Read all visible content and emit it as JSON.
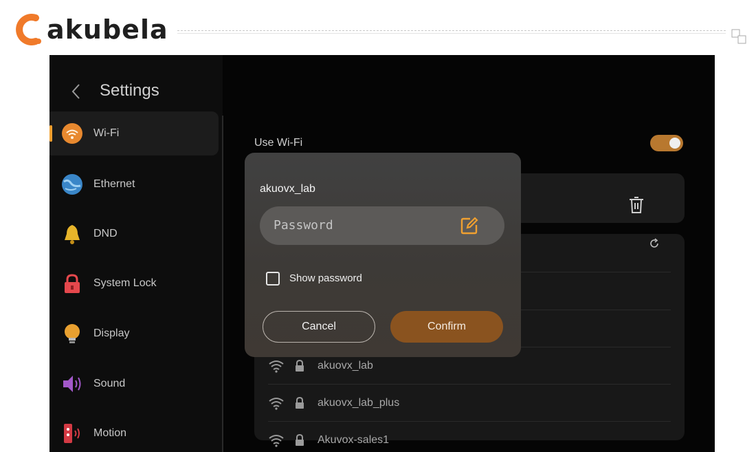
{
  "brand": {
    "name": "akubela",
    "accent": "#f0a030"
  },
  "header": {
    "title": "Settings"
  },
  "sidebar": {
    "items": [
      {
        "label": "Wi-Fi",
        "icon": "wifi-icon",
        "active": true
      },
      {
        "label": "Ethernet",
        "icon": "globe-icon",
        "active": false
      },
      {
        "label": "DND",
        "icon": "bell-icon",
        "active": false
      },
      {
        "label": "System Lock",
        "icon": "lock-icon",
        "active": false
      },
      {
        "label": "Display",
        "icon": "bulb-icon",
        "active": false
      },
      {
        "label": "Sound",
        "icon": "speaker-icon",
        "active": false
      },
      {
        "label": "Motion",
        "icon": "motion-sensor-icon",
        "active": false
      }
    ]
  },
  "wifi": {
    "use_label": "Use Wi-Fi",
    "enabled": true,
    "networks": [
      {
        "name": "akuovx_lab",
        "locked": true
      },
      {
        "name": "akuovx_lab_plus",
        "locked": true
      },
      {
        "name": "Akuvox-sales1",
        "locked": true
      }
    ]
  },
  "dialog": {
    "title": "akuovx_lab",
    "password_placeholder": "Password",
    "show_password_label": "Show password",
    "show_password_checked": false,
    "cancel_label": "Cancel",
    "confirm_label": "Confirm"
  },
  "colors": {
    "toggle_on": "#b8782f",
    "confirm": "#8a531f",
    "accent": "#f0a030"
  }
}
